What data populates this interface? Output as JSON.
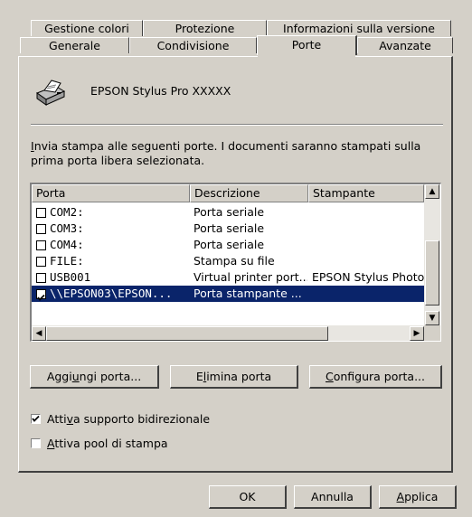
{
  "tabs_back": [
    {
      "label": "Gestione colori"
    },
    {
      "label": "Protezione"
    },
    {
      "label": "Informazioni sulla versione"
    }
  ],
  "tabs_front": [
    {
      "label": "Generale"
    },
    {
      "label": "Condivisione"
    },
    {
      "label": "Porte",
      "active": true
    },
    {
      "label": "Avanzate"
    }
  ],
  "printer": {
    "name": "EPSON Stylus Pro XXXXX",
    "icon": "printer-icon"
  },
  "instructions": "Invia stampa alle seguenti porte. I documenti saranno stampati sulla prima porta libera selezionata.",
  "instructions_line1": "nvia stampa alle seguenti porte. I documenti saranno stampati sulla",
  "instructions_line1_mnemonic": "I",
  "instructions_line2": "prima porta libera selezionata.",
  "ports_table": {
    "columns": [
      "Porta",
      "Descrizione",
      "Stampante"
    ],
    "rows": [
      {
        "port": "COM2:",
        "description": "Porta seriale",
        "printer": "",
        "checked": false,
        "selected": false
      },
      {
        "port": "COM3:",
        "description": "Porta seriale",
        "printer": "",
        "checked": false,
        "selected": false
      },
      {
        "port": "COM4:",
        "description": "Porta seriale",
        "printer": "",
        "checked": false,
        "selected": false
      },
      {
        "port": "FILE:",
        "description": "Stampa su file",
        "printer": "",
        "checked": false,
        "selected": false
      },
      {
        "port": "USB001",
        "description": "Virtual printer port...",
        "printer": "EPSON Stylus Photo",
        "checked": false,
        "selected": false
      },
      {
        "port": "\\\\EPSON03\\EPSON...",
        "description": "Porta stampante ...",
        "printer": "",
        "checked": true,
        "selected": true
      }
    ]
  },
  "buttons": {
    "add_port": "Aggiungi porta...",
    "add_port_pre": "Aggi",
    "add_port_mnemonic": "u",
    "add_port_post": "ngi porta...",
    "delete_port": "Elimina porta",
    "delete_port_pre": "E",
    "delete_port_mnemonic": "l",
    "delete_port_post": "imina porta",
    "configure_port": "Configura porta...",
    "configure_port_pre": "",
    "configure_port_mnemonic": "C",
    "configure_port_post": "onfigura porta...",
    "ok": "OK",
    "cancel": "Annulla",
    "apply": "Applica",
    "apply_mnemonic": "A",
    "apply_post": "pplica"
  },
  "options": {
    "bidirectional": {
      "label": "Attiva supporto bidirezionale",
      "pre": "Atti",
      "mnemonic": "v",
      "post": "a supporto bidirezionale",
      "checked": true
    },
    "pool": {
      "label": "Attiva pool di stampa",
      "pre": "",
      "mnemonic": "A",
      "post": "ttiva pool di stampa",
      "checked": false
    }
  }
}
